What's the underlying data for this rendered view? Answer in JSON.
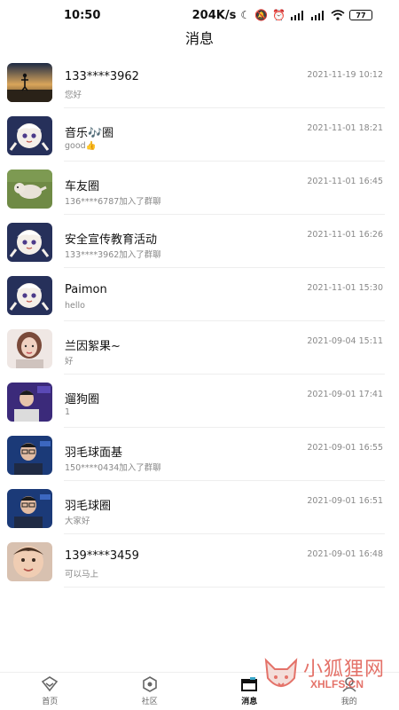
{
  "status_bar": {
    "time": "10:50",
    "network_speed": "204K/s",
    "battery": "77",
    "icons": [
      "moon-icon",
      "mute-icon",
      "alarm-icon",
      "hd-signal-icon",
      "hd-signal-icon-2",
      "wifi-icon"
    ]
  },
  "page": {
    "title": "消息"
  },
  "conversations": [
    {
      "name": "133****3962",
      "preview": "您好",
      "time": "2021-11-19 10:12",
      "avatar": "sunset-silhouette"
    },
    {
      "name": "音乐🎶圈",
      "preview": "good👍",
      "time": "2021-11-01 18:21",
      "avatar": "paimon"
    },
    {
      "name": "车友圈",
      "preview": "136****6787加入了群聊",
      "time": "2021-11-01 16:45",
      "avatar": "dog-on-grass"
    },
    {
      "name": "安全宣传教育活动",
      "preview": "133****3962加入了群聊",
      "time": "2021-11-01 16:26",
      "avatar": "paimon"
    },
    {
      "name": "Paimon",
      "preview": "hello",
      "time": "2021-11-01 15:30",
      "avatar": "paimon"
    },
    {
      "name": "兰因絮果~",
      "preview": "好",
      "time": "2021-09-04 15:11",
      "avatar": "woman-portrait"
    },
    {
      "name": "遛狗圈",
      "preview": "1",
      "time": "2021-09-01 17:41",
      "avatar": "man-stage"
    },
    {
      "name": "羽毛球面基",
      "preview": "150****0434加入了群聊",
      "time": "2021-09-01 16:55",
      "avatar": "man-glasses"
    },
    {
      "name": "羽毛球圈",
      "preview": "大家好",
      "time": "2021-09-01 16:51",
      "avatar": "man-glasses"
    },
    {
      "name": "139****3459",
      "preview": "可以马上",
      "time": "2021-09-01 16:48",
      "avatar": "child-face"
    }
  ],
  "tab_bar": {
    "tabs": [
      {
        "label": "首页",
        "icon": "home-diamond-icon",
        "active": false
      },
      {
        "label": "社区",
        "icon": "community-hex-icon",
        "active": false
      },
      {
        "label": "消息",
        "icon": "message-box-icon",
        "active": true
      },
      {
        "label": "我的",
        "icon": "profile-icon",
        "active": false
      }
    ]
  },
  "watermark": {
    "line1": "小狐狸网",
    "line2": "XHLFS.CN"
  },
  "colors": {
    "accent": "#111111",
    "muted": "#888888",
    "watermark": "#e05a4f"
  }
}
